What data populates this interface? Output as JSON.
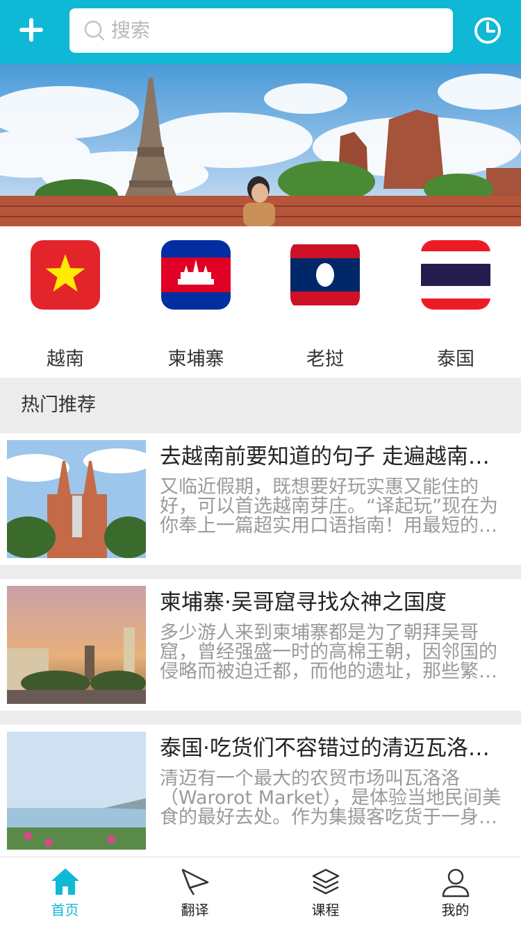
{
  "header": {
    "search_placeholder": "搜索",
    "add_icon": "plus-icon",
    "history_icon": "clock-icon",
    "accent_color": "#0fb9d6"
  },
  "banner": {
    "image": "ancient-temple-ruins-photo"
  },
  "countries": [
    {
      "name": "越南",
      "flag": "vietnam-flag-icon"
    },
    {
      "name": "柬埔寨",
      "flag": "cambodia-flag-icon"
    },
    {
      "name": "老挝",
      "flag": "laos-flag-icon"
    },
    {
      "name": "泰国",
      "flag": "thailand-flag-icon"
    }
  ],
  "section": {
    "title": "热门推荐"
  },
  "articles": [
    {
      "title": "去越南前要知道的句子 走遍越南…",
      "desc": "又临近假期，既想要好玩实惠又能住的好，可以首选越南芽庄。“译起玩”现在为你奉上一篇超实用口语指南！用最短的…"
    },
    {
      "title": "柬埔寨·吴哥窟寻找众神之国度",
      "desc": "多少游人来到柬埔寨都是为了朝拜吴哥窟，曾经强盛一时的高棉王朝，因邻国的侵略而被迫迁都，而他的遗址，那些繁…"
    },
    {
      "title": "泰国·吃货们不容错过的清迈瓦洛…",
      "desc": "清迈有一个最大的农贸市场叫瓦洛洛（Warorot Market），是体验当地民间美食的最好去处。作为集摄客吃货于一身…"
    }
  ],
  "tabbar": [
    {
      "label": "首页",
      "icon": "home-icon",
      "active": true
    },
    {
      "label": "翻译",
      "icon": "paper-plane-icon",
      "active": false
    },
    {
      "label": "课程",
      "icon": "layers-icon",
      "active": false
    },
    {
      "label": "我的",
      "icon": "user-icon",
      "active": false
    }
  ]
}
